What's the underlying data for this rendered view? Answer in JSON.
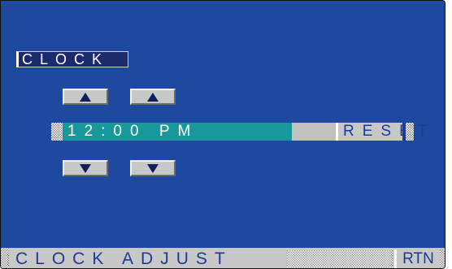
{
  "screen": {
    "title": "CLOCK",
    "time": "12:00 PM",
    "reset_label": "RESET",
    "hour_up_icon": "triangle-up",
    "minute_up_icon": "triangle-up",
    "hour_down_icon": "triangle-down",
    "minute_down_icon": "triangle-down"
  },
  "bottom_bar": {
    "label": "CLOCK ADJUST",
    "rtn_label": "RTN"
  },
  "colors": {
    "background": "#1d4aa0",
    "time_highlight": "#17999b",
    "button_face": "#c8c8c8",
    "text_on_button": "#1d3b94"
  }
}
